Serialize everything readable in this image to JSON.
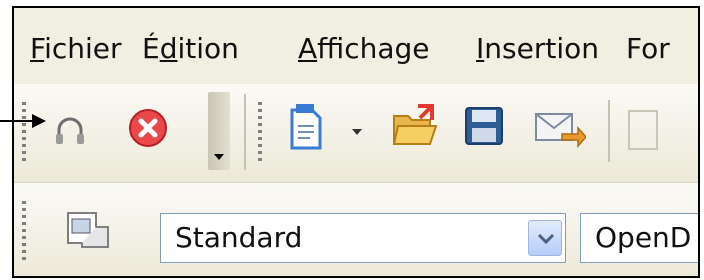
{
  "menu": {
    "items": [
      {
        "label": "Fichier",
        "accel": "F",
        "rest": "ichier"
      },
      {
        "label": "Édition",
        "pre": "É",
        "accel": "d",
        "rest": "ition"
      },
      {
        "label": "Affichage",
        "accel": "A",
        "rest": "ffichage"
      },
      {
        "label": "Insertion",
        "accel": "I",
        "rest": "nsertion"
      },
      {
        "label": "For",
        "accel": "",
        "rest": "For"
      }
    ]
  },
  "toolbar_standard": {
    "icons": [
      "headphones-icon",
      "close-error-icon",
      "toolbar-dropdown-icon",
      "new-document-icon",
      "dropdown-arrow-icon",
      "open-folder-icon",
      "save-icon",
      "email-icon"
    ]
  },
  "toolbar_format": {
    "styles_icon": "styles-formatting-icon",
    "paragraph_style": "Standard",
    "font_name": "OpenD"
  },
  "colors": {
    "menubar_bg": "#f1efe2",
    "toolbar_top": "#fbfaf6",
    "toolbar_bottom": "#ece9d8",
    "accent": "#e81c24",
    "combo_border": "#7f9db9"
  }
}
